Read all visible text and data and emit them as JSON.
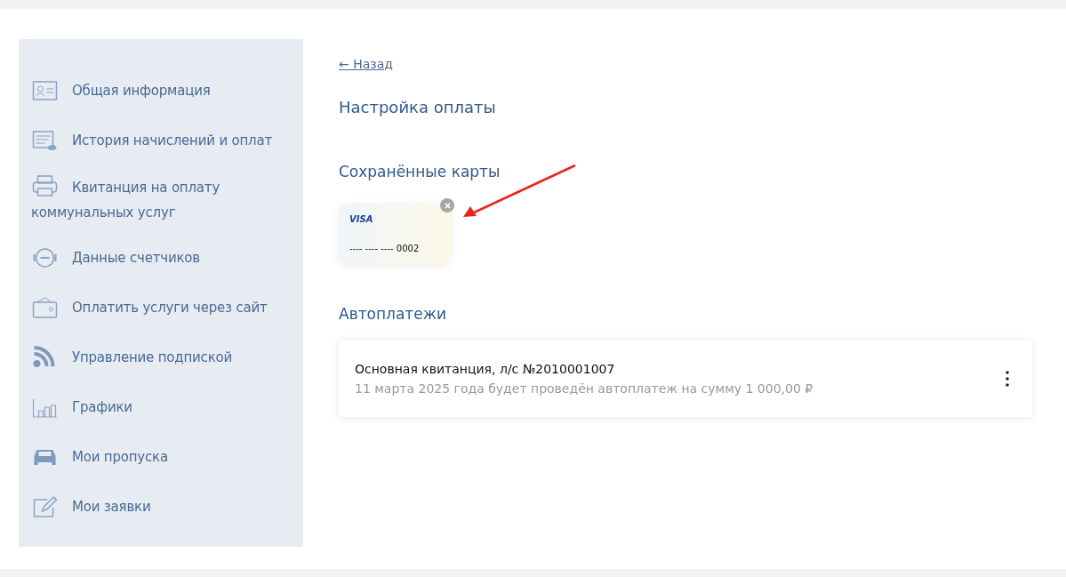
{
  "sidebar": {
    "items": [
      {
        "label": "Общая информация"
      },
      {
        "label": "История начислений и оплат"
      },
      {
        "label": "Квитанция на оплату коммунальных услуг"
      },
      {
        "label": "Данные счетчиков"
      },
      {
        "label": "Оплатить услуги через сайт"
      },
      {
        "label": "Управление подпиской"
      },
      {
        "label": "Графики"
      },
      {
        "label": "Мои пропуска"
      },
      {
        "label": "Мои заявки"
      }
    ]
  },
  "back_link": "← Назад",
  "title": "Настройка оплаты",
  "saved_cards": {
    "heading": "Сохранённые карты",
    "cards": [
      {
        "brand": "VISA",
        "number": "---- ---- ---- 0002"
      }
    ]
  },
  "autopayments": {
    "heading": "Автоплатежи",
    "items": [
      {
        "title": "Основная квитанция, л/с №2010001007",
        "description": "11 марта 2025 года будет проведён автоплатеж на сумму 1 000,00 ₽"
      }
    ]
  }
}
